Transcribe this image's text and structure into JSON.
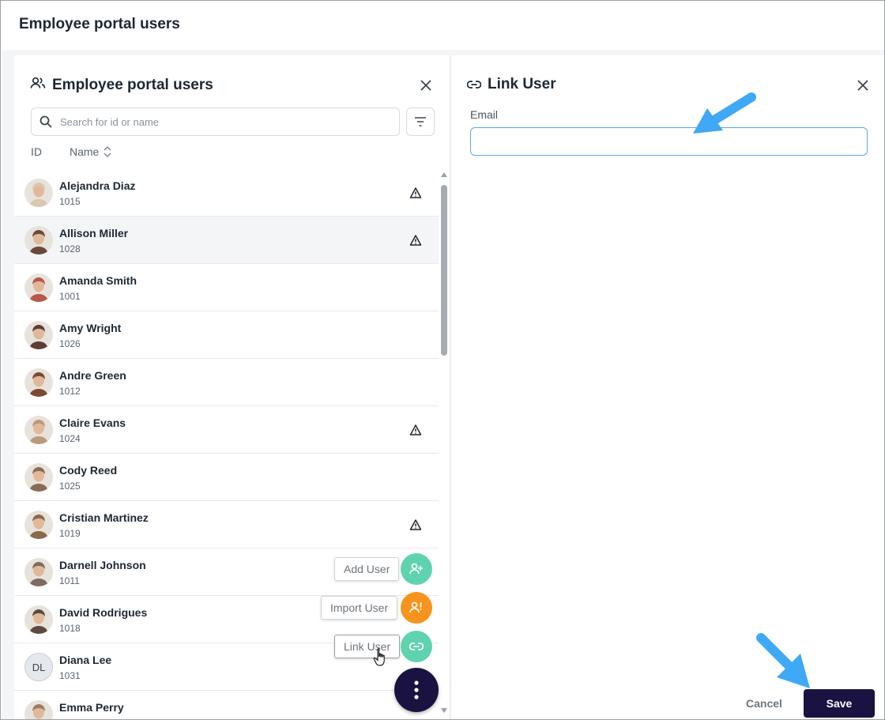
{
  "page": {
    "title": "Employee portal users"
  },
  "left_panel": {
    "title": "Employee portal users",
    "search_placeholder": "Search for id or name",
    "columns": {
      "id": "ID",
      "name": "Name"
    },
    "users": [
      {
        "name": "Alejandra Diaz",
        "id": "1015",
        "warning": true,
        "avatar_color": "#d9c7b0"
      },
      {
        "name": "Allison Miller",
        "id": "1028",
        "warning": true,
        "avatar_color": "#6b4a3a"
      },
      {
        "name": "Amanda Smith",
        "id": "1001",
        "warning": false,
        "avatar_color": "#b8574a"
      },
      {
        "name": "Amy Wright",
        "id": "1026",
        "warning": false,
        "avatar_color": "#5b3e36"
      },
      {
        "name": "Andre Green",
        "id": "1012",
        "warning": false,
        "avatar_color": "#7a4a33"
      },
      {
        "name": "Claire Evans",
        "id": "1024",
        "warning": true,
        "avatar_color": "#b99a7c"
      },
      {
        "name": "Cody Reed",
        "id": "1025",
        "warning": false,
        "avatar_color": "#8b6a55"
      },
      {
        "name": "Cristian Martinez",
        "id": "1019",
        "warning": true,
        "avatar_color": "#8a6a48"
      },
      {
        "name": "Darnell Johnson",
        "id": "1011",
        "warning": false,
        "avatar_color": "#7d6b60"
      },
      {
        "name": "David Rodrigues",
        "id": "1018",
        "warning": false,
        "avatar_color": "#5e4a42"
      },
      {
        "name": "Diana Lee",
        "id": "1031",
        "warning": false,
        "initials": "DL"
      },
      {
        "name": "Emma Perry",
        "id": "",
        "warning": false,
        "avatar_color": "#9a7b66"
      }
    ],
    "fab": {
      "add_label": "Add User",
      "import_label": "Import User",
      "link_label": "Link User"
    }
  },
  "right_panel": {
    "title": "Link User",
    "email_label": "Email",
    "email_value": "",
    "cancel_label": "Cancel",
    "save_label": "Save"
  },
  "colors": {
    "accent_dark": "#1a1240",
    "fab_green": "#5fd3b0",
    "fab_orange": "#f7941d",
    "arrow_blue": "#3fa9f5"
  },
  "icons": {
    "left_title": "users-icon",
    "right_title": "link-icon",
    "search": "search-icon",
    "filter": "filter-icon",
    "sort": "sort-icon",
    "close": "close-icon",
    "warning": "warning-icon"
  }
}
